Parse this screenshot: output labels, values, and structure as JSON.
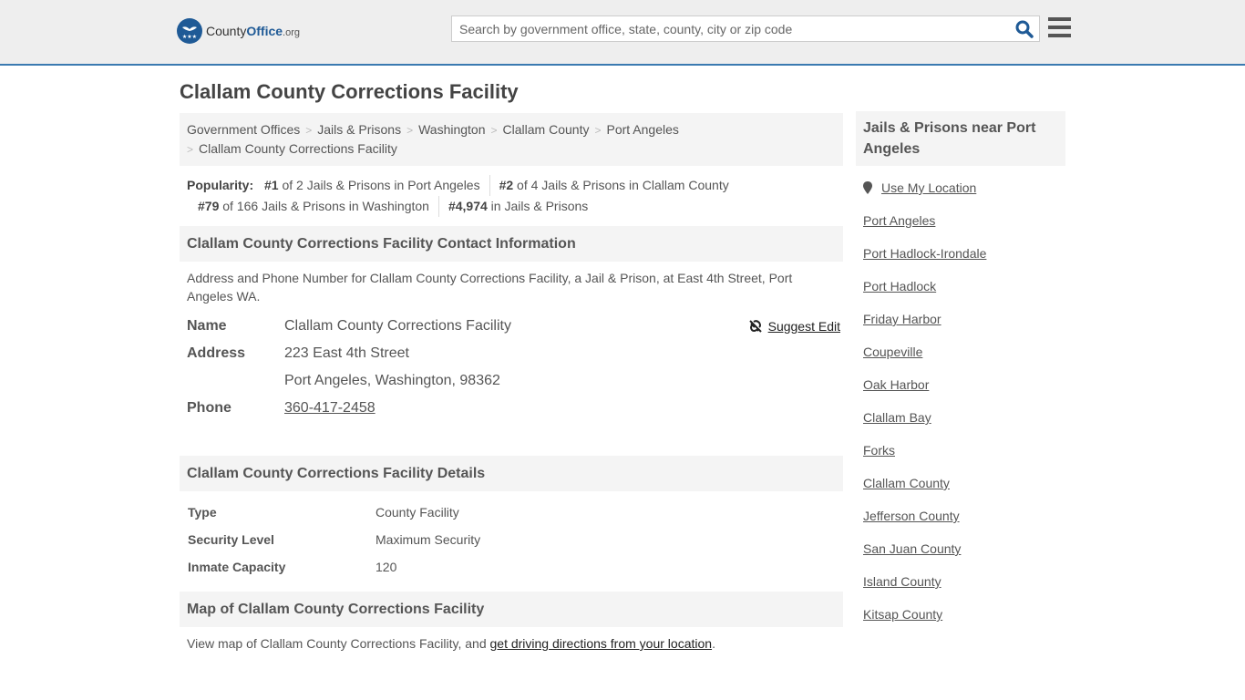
{
  "header": {
    "logo": {
      "part1": "County",
      "part2": "Office",
      "part3": ".org"
    },
    "search_placeholder": "Search by government office, state, county, city or zip code"
  },
  "page_title": "Clallam County Corrections Facility",
  "breadcrumbs": [
    "Government Offices",
    "Jails & Prisons",
    "Washington",
    "Clallam County",
    "Port Angeles",
    "Clallam County Corrections Facility"
  ],
  "popularity": {
    "label": "Popularity:",
    "items": [
      {
        "rank": "#1",
        "text": " of 2 Jails & Prisons in Port Angeles"
      },
      {
        "rank": "#2",
        "text": " of 4 Jails & Prisons in Clallam County"
      },
      {
        "rank": "#79",
        "text": " of 166 Jails & Prisons in Washington"
      },
      {
        "rank": "#4,974",
        "text": " in Jails & Prisons"
      }
    ]
  },
  "contact": {
    "heading": "Clallam County Corrections Facility Contact Information",
    "description": "Address and Phone Number for Clallam County Corrections Facility, a Jail & Prison, at East 4th Street, Port Angeles WA.",
    "suggest_edit": "Suggest Edit",
    "name_label": "Name",
    "name": "Clallam County Corrections Facility",
    "address_label": "Address",
    "address1": "223 East 4th Street",
    "address2": "Port Angeles, Washington, 98362",
    "phone_label": "Phone",
    "phone": "360-417-2458"
  },
  "details": {
    "heading": "Clallam County Corrections Facility Details",
    "rows": [
      {
        "label": "Type",
        "value": "County Facility"
      },
      {
        "label": "Security Level",
        "value": "Maximum Security"
      },
      {
        "label": "Inmate Capacity",
        "value": "120"
      }
    ]
  },
  "map": {
    "heading": "Map of Clallam County Corrections Facility",
    "text": "View map of Clallam County Corrections Facility, and ",
    "link": "get driving directions from your location",
    "end": "."
  },
  "sidebar": {
    "heading": "Jails & Prisons near Port Angeles",
    "use_location": "Use My Location",
    "links": [
      "Port Angeles",
      "Port Hadlock-Irondale",
      "Port Hadlock",
      "Friday Harbor",
      "Coupeville",
      "Oak Harbor",
      "Clallam Bay",
      "Forks",
      "Clallam County",
      "Jefferson County",
      "San Juan County",
      "Island County",
      "Kitsap County"
    ]
  }
}
